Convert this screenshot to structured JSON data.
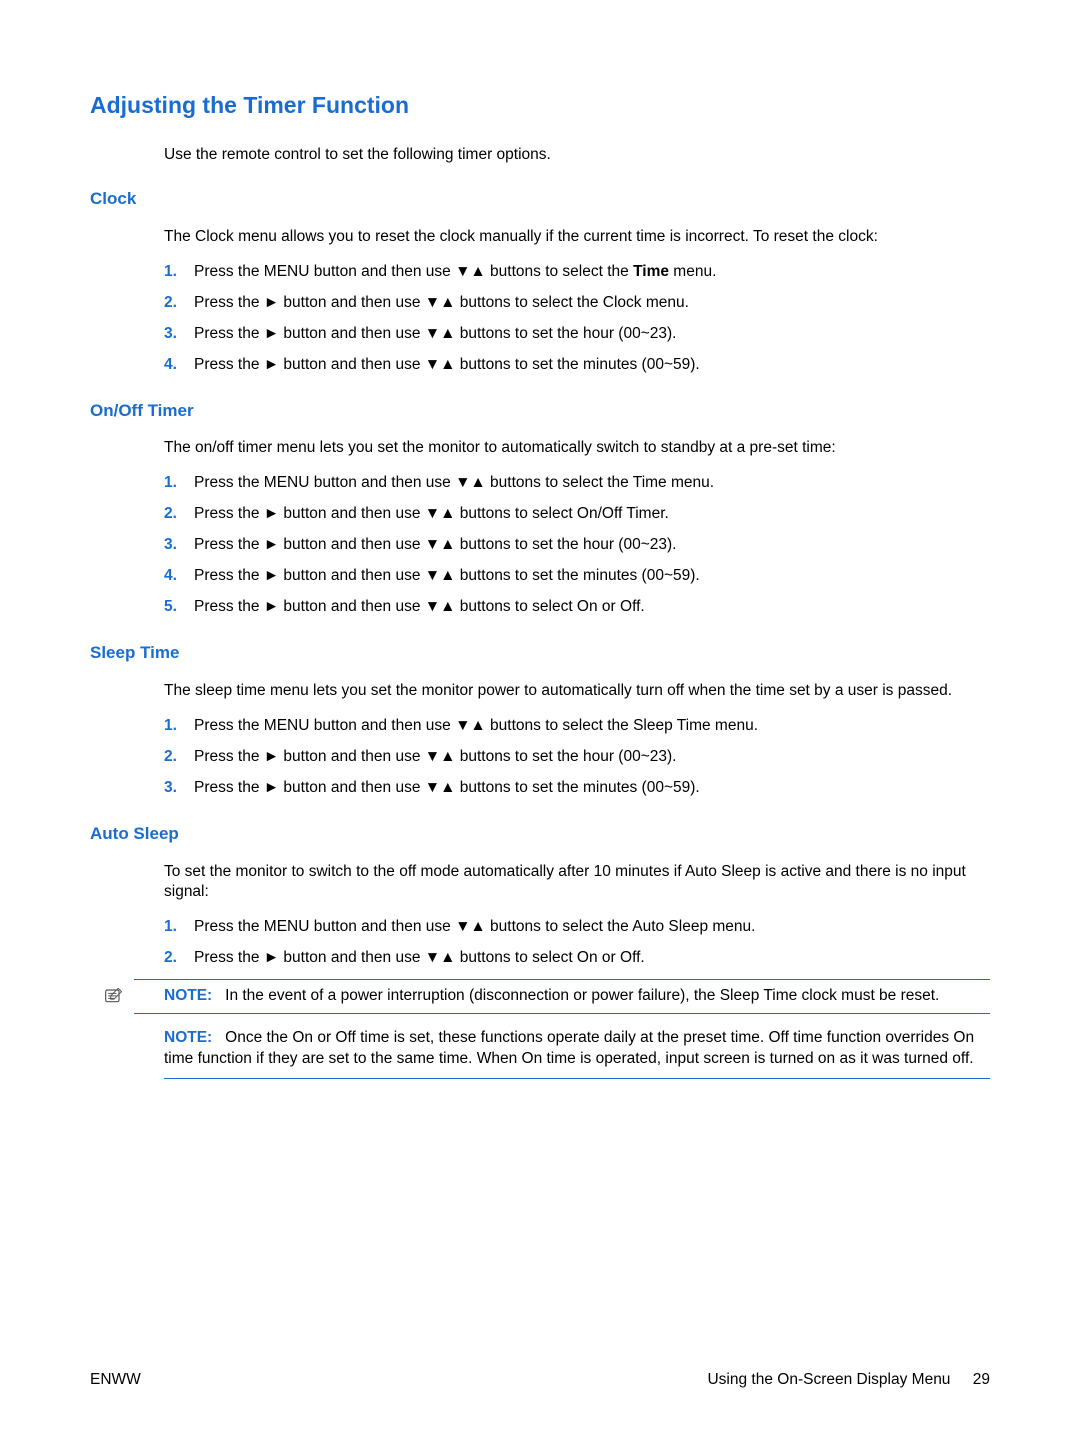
{
  "title": "Adjusting the Timer Function",
  "intro": "Use the remote control to set the following timer options.",
  "clock": {
    "heading": "Clock",
    "desc": "The Clock menu allows you to reset the clock manually if the current time is incorrect. To reset the clock:",
    "step1_a": "Press the MENU button and then use ▼▲ buttons to select the ",
    "step1_bold": "Time",
    "step1_b": " menu.",
    "step2": "Press the ► button and then use ▼▲ buttons to select the Clock menu.",
    "step3": "Press the ► button and then use ▼▲ buttons to set the hour (00~23).",
    "step4": "Press the ► button and then use ▼▲ buttons to set the minutes (00~59)."
  },
  "onoff": {
    "heading": "On/Off Timer",
    "desc": "The on/off timer menu lets you set the monitor to automatically switch to standby at a pre-set time:",
    "step1": "Press the MENU button and then use ▼▲ buttons to select the Time menu.",
    "step2": "Press the ► button and then use ▼▲ buttons to select On/Off Timer.",
    "step3": "Press the ► button and then use ▼▲ buttons to set the hour (00~23).",
    "step4": "Press the ► button and then use ▼▲ buttons to set the minutes (00~59).",
    "step5": "Press the ► button and then use ▼▲ buttons to select On or Off."
  },
  "sleep": {
    "heading": "Sleep Time",
    "desc": "The sleep time menu lets you set the monitor power to automatically turn off when the time set by a user is passed.",
    "step1": "Press the MENU button and then use ▼▲ buttons to select the Sleep Time menu.",
    "step2": "Press the ► button and then use ▼▲ buttons to set the hour (00~23).",
    "step3": "Press the ► button and then use ▼▲ buttons to set the minutes (00~59)."
  },
  "auto": {
    "heading": "Auto Sleep",
    "desc": "To set the monitor to switch to the off mode automatically after 10 minutes if Auto Sleep is active and there is no input signal:",
    "step1": "Press the MENU button and then use ▼▲ buttons to select the Auto Sleep menu.",
    "step2": "Press the ► button and then use ▼▲ buttons to select On or Off."
  },
  "notes": {
    "label": "NOTE:",
    "n1": "In the event of a power interruption (disconnection or power failure), the Sleep Time clock must be reset.",
    "n2": "Once the On or Off time is set, these functions operate daily at the preset time. Off time function overrides On time function if they are set to the same time. When On time is operated, input screen is turned on as it was turned off."
  },
  "nums": {
    "n1": "1.",
    "n2": "2.",
    "n3": "3.",
    "n4": "4.",
    "n5": "5."
  },
  "footer": {
    "left": "ENWW",
    "right": "Using the On-Screen Display Menu",
    "page": "29"
  }
}
